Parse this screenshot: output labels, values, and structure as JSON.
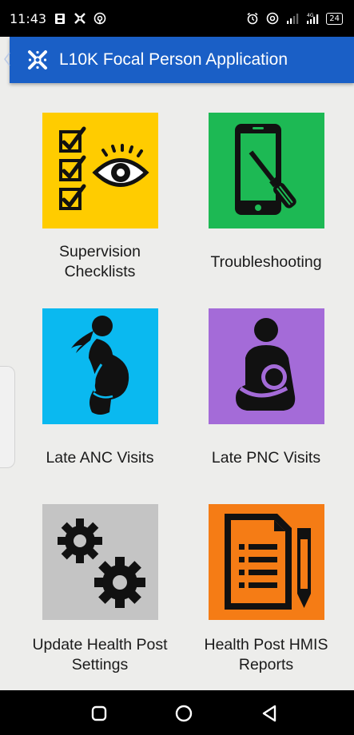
{
  "status_bar": {
    "time": "11:43",
    "left_icons": [
      "sim-card-icon",
      "app-logo-icon",
      "wireless-icon"
    ],
    "right_icons": [
      "alarm-icon",
      "hotspot-icon",
      "signal-icon",
      "signal-4g-icon"
    ],
    "battery_level": "24"
  },
  "app_bar": {
    "title": "L10K Focal Person Application",
    "color": "#1a5fc6"
  },
  "menu": {
    "items": [
      {
        "label": "Supervision Checklists",
        "icon": "checklist-eye-icon",
        "color": "#ffcc00"
      },
      {
        "label": "Troubleshooting",
        "icon": "phone-screwdriver-icon",
        "color": "#1db954"
      },
      {
        "label": "Late ANC Visits",
        "icon": "pregnant-woman-icon",
        "color": "#0ab9f0"
      },
      {
        "label": "Late PNC Visits",
        "icon": "breastfeeding-icon",
        "color": "#a46bd8"
      },
      {
        "label": "Update Health Post Settings",
        "icon": "gears-icon",
        "color": "#c4c4c4"
      },
      {
        "label": "Health Post HMIS Reports",
        "icon": "report-pencil-icon",
        "color": "#f57c15"
      }
    ]
  },
  "nav_bar": {
    "buttons": [
      "recents-icon",
      "home-icon",
      "back-icon"
    ]
  }
}
